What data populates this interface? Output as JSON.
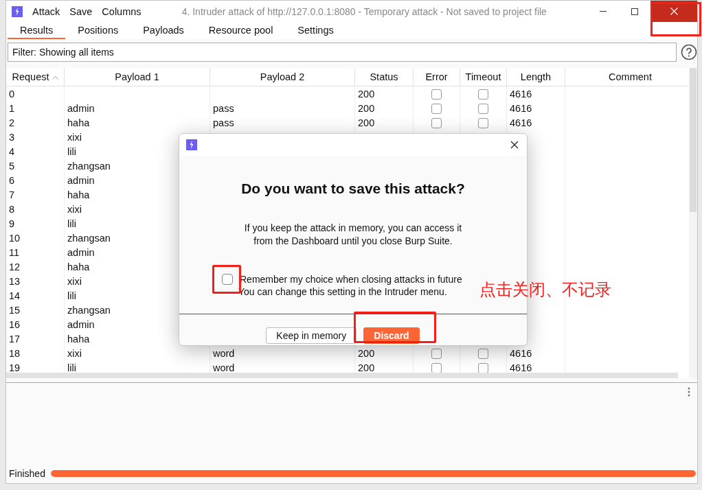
{
  "window": {
    "title": "4. Intruder attack of http://127.0.0.1:8080 - Temporary attack - Not saved to project file",
    "menus": [
      "Attack",
      "Save",
      "Columns"
    ],
    "close_highlighted": true
  },
  "tabs": [
    {
      "label": "Results",
      "selected": true
    },
    {
      "label": "Positions",
      "selected": false
    },
    {
      "label": "Payloads",
      "selected": false
    },
    {
      "label": "Resource pool",
      "selected": false
    },
    {
      "label": "Settings",
      "selected": false
    }
  ],
  "filter": {
    "text": "Filter: Showing all items"
  },
  "table": {
    "columns": [
      {
        "label": "Request",
        "sorted": true
      },
      {
        "label": "Payload 1",
        "sorted": false
      },
      {
        "label": "Payload 2",
        "sorted": false
      },
      {
        "label": "Status",
        "sorted": false
      },
      {
        "label": "Error",
        "sorted": false
      },
      {
        "label": "Timeout",
        "sorted": false
      },
      {
        "label": "Length",
        "sorted": false
      },
      {
        "label": "Comment",
        "sorted": false
      }
    ],
    "rows": [
      {
        "request": "0",
        "status": "200",
        "error": false,
        "timeout": false,
        "length": "4616"
      },
      {
        "request": "1",
        "payload1": "admin",
        "payload2": "pass",
        "status": "200",
        "error": false,
        "timeout": false,
        "length": "4616"
      },
      {
        "request": "2",
        "payload1": "haha",
        "payload2": "pass",
        "status": "200",
        "error": false,
        "timeout": false,
        "length": "4616"
      },
      {
        "request": "3",
        "payload1": "xixi"
      },
      {
        "request": "4",
        "payload1": "lili"
      },
      {
        "request": "5",
        "payload1": "zhangsan"
      },
      {
        "request": "6",
        "payload1": "admin"
      },
      {
        "request": "7",
        "payload1": "haha"
      },
      {
        "request": "8",
        "payload1": "xixi"
      },
      {
        "request": "9",
        "payload1": "lili"
      },
      {
        "request": "10",
        "payload1": "zhangsan"
      },
      {
        "request": "11",
        "payload1": "admin"
      },
      {
        "request": "12",
        "payload1": "haha"
      },
      {
        "request": "13",
        "payload1": "xixi"
      },
      {
        "request": "14",
        "payload1": "lili"
      },
      {
        "request": "15",
        "payload1": "zhangsan"
      },
      {
        "request": "16",
        "payload1": "admin"
      },
      {
        "request": "17",
        "payload1": "haha"
      },
      {
        "request": "18",
        "payload1": "xixi",
        "payload2": "word",
        "status": "200",
        "error": false,
        "timeout": false,
        "length": "4616"
      },
      {
        "request": "19",
        "payload1": "lili",
        "payload2": "word",
        "status": "200",
        "error": false,
        "timeout": false,
        "length": "4616"
      }
    ]
  },
  "status": {
    "text": "Finished",
    "level": 1
  },
  "dialog": {
    "heading": "Do you want to save this attack?",
    "message": "If you keep the attack in memory, you can access it from the Dashboard until you close Burp Suite.",
    "remember": {
      "label": "Remember my choice when closing attacks in future",
      "checked": false,
      "highlighted": true
    },
    "hint": "You can change this setting in the Intruder menu.",
    "buttons": [
      {
        "label": "Keep in memory",
        "kind": "secondary",
        "highlighted": false
      },
      {
        "label": "Discard",
        "kind": "primary",
        "highlighted": true
      }
    ]
  },
  "annotation": {
    "text": "点击关闭、不记录"
  }
}
